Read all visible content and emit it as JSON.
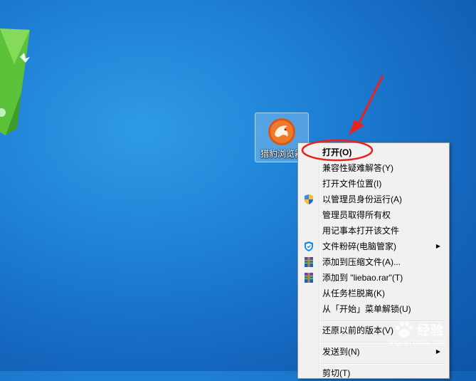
{
  "desktop": {
    "icon_label": "猎豹浏览器"
  },
  "context_menu": {
    "items": [
      {
        "label": "打开(O)",
        "bold": true,
        "icon": ""
      },
      {
        "label": "兼容性疑难解答(Y)",
        "icon": ""
      },
      {
        "label": "打开文件位置(I)",
        "icon": ""
      },
      {
        "label": "以管理员身份运行(A)",
        "icon": "uac-shield-icon"
      },
      {
        "label": "管理员取得所有权",
        "icon": ""
      },
      {
        "label": "用记事本打开该文件",
        "icon": ""
      },
      {
        "label": "文件粉碎(电脑管家)",
        "icon": "qq-pc-manager-icon",
        "submenu": true
      },
      {
        "label": "添加到压缩文件(A)...",
        "icon": "winrar-icon"
      },
      {
        "label": "添加到 \"liebao.rar\"(T)",
        "icon": "winrar-icon"
      },
      {
        "label": "从任务栏脱离(K)",
        "icon": ""
      },
      {
        "label": "从「开始」菜单解锁(U)",
        "icon": ""
      },
      {
        "label": "还原以前的版本(V)",
        "icon": ""
      },
      {
        "label": "发送到(N)",
        "icon": "",
        "submenu": true
      },
      {
        "label": "剪切(T)",
        "icon": ""
      }
    ]
  },
  "watermark": {
    "text": "经验",
    "url": "jingyan.baidu.com"
  },
  "colors": {
    "desktop_blue": "#1f82d6",
    "annotation_red": "#e8231f",
    "menu_bg": "#f1f1f1"
  }
}
